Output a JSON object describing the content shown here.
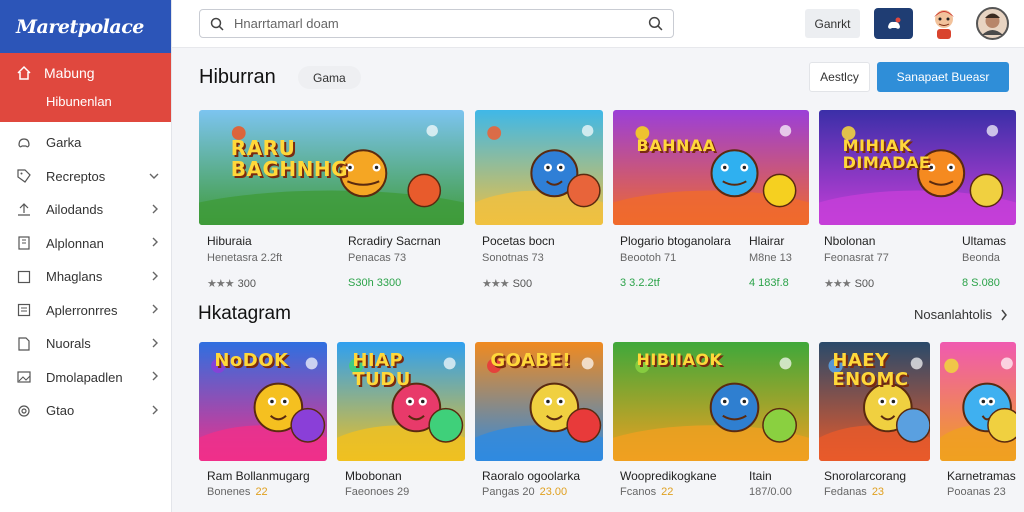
{
  "app": {
    "logo": "Maretpolace"
  },
  "sidebar": {
    "active": {
      "label": "Mabung",
      "sub": "Hibunenlan"
    },
    "items": [
      {
        "label": "Garka",
        "icon": "game-icon",
        "chev": false
      },
      {
        "label": "Recreptos",
        "icon": "tag-icon",
        "chev": true,
        "dir": "down"
      },
      {
        "label": "Ailodands",
        "icon": "upload-icon",
        "chev": true,
        "dir": "right"
      },
      {
        "label": "Alplonnan",
        "icon": "building-icon",
        "chev": true,
        "dir": "right"
      },
      {
        "label": "Mhaglans",
        "icon": "square-icon",
        "chev": true,
        "dir": "right"
      },
      {
        "label": "Aplerronrres",
        "icon": "list-icon",
        "chev": true,
        "dir": "right"
      },
      {
        "label": "Nuorals",
        "icon": "document-icon",
        "chev": true,
        "dir": "right"
      },
      {
        "label": "Dmolapadlen",
        "icon": "image-icon",
        "chev": true,
        "dir": "right"
      },
      {
        "label": "Gtao",
        "icon": "gear-icon",
        "chev": true,
        "dir": "right"
      }
    ]
  },
  "topbar": {
    "search_placeholder": "Hnarrtamarl doam",
    "gamit_label": "Ganrkt"
  },
  "section1": {
    "title": "Hiburran",
    "chip": "Gama",
    "outline_btn": "Aestlcy",
    "primary_btn": "Sanapaet Bueasr",
    "cards": [
      {
        "thumb_text": "RARU BAGHNHG",
        "title": "Hiburaia",
        "sub": "Henetasra 2.2ft",
        "meta": "300",
        "meta_stars": true
      },
      {
        "thumb_text": "",
        "title": "Rcradiry Sacrnan",
        "sub": "Penacas 73",
        "meta": "S30h 3300",
        "meta_stars": false,
        "meta_green": true
      },
      {
        "thumb_text": "BAHNAA",
        "title": "Pocetas bocn",
        "sub": "Sonotnas 73",
        "meta": "S00",
        "meta_stars": true
      },
      {
        "thumb_text": "",
        "title": "Plogario btoganolara",
        "sub": "Beootoh 71",
        "meta": "3 3.2.2tf",
        "meta_stars": false,
        "meta_green": true
      },
      {
        "thumb_text": "",
        "title": "Hlairar",
        "sub": "M8ne 13",
        "meta": "4 183f.8",
        "meta_stars": false,
        "meta_green": true
      },
      {
        "thumb_text": "MIHIAK DIMADAE",
        "title": "Nbolonan",
        "sub": "Feonasrat 77",
        "meta": "S00",
        "meta_stars": true
      },
      {
        "thumb_text": "",
        "title": "Ultamas",
        "sub": "Beonda",
        "meta": "8 S.080",
        "meta_stars": false,
        "meta_green": true
      }
    ]
  },
  "section2": {
    "title": "Hkatagram",
    "see_all": "Nosanlahtolis",
    "cards": [
      {
        "thumb_text": "NoDOK",
        "title": "Ram Bollanmugarg",
        "sub": "Bonenes",
        "price": "22"
      },
      {
        "thumb_text": "HIAP TUDU",
        "title": "Mbobonan",
        "sub": "Faeonoes 29",
        "price": ""
      },
      {
        "thumb_text": "GOABE!",
        "title": "Raoralo ogoolarka",
        "sub": "Pangas 20",
        "price": "23.00"
      },
      {
        "thumb_text": "HIBIIAOK",
        "title": "Woopredikogkane",
        "sub": "Fcanos",
        "price": "22"
      },
      {
        "thumb_text": "",
        "title": "Itain",
        "sub": "187/0.00",
        "price": ""
      },
      {
        "thumb_text": "HAEY ENOMC",
        "title": "Snorolarcorang",
        "sub": "Fedanas",
        "price": "23"
      },
      {
        "thumb_text": "",
        "title": "Karnetramas",
        "sub": "Pooanas 23",
        "price": ""
      }
    ]
  },
  "colors": {
    "brand_blue": "#2c55b8",
    "active_red": "#e0483e",
    "primary": "#2f8ed8",
    "price_green": "#2ca34a"
  }
}
